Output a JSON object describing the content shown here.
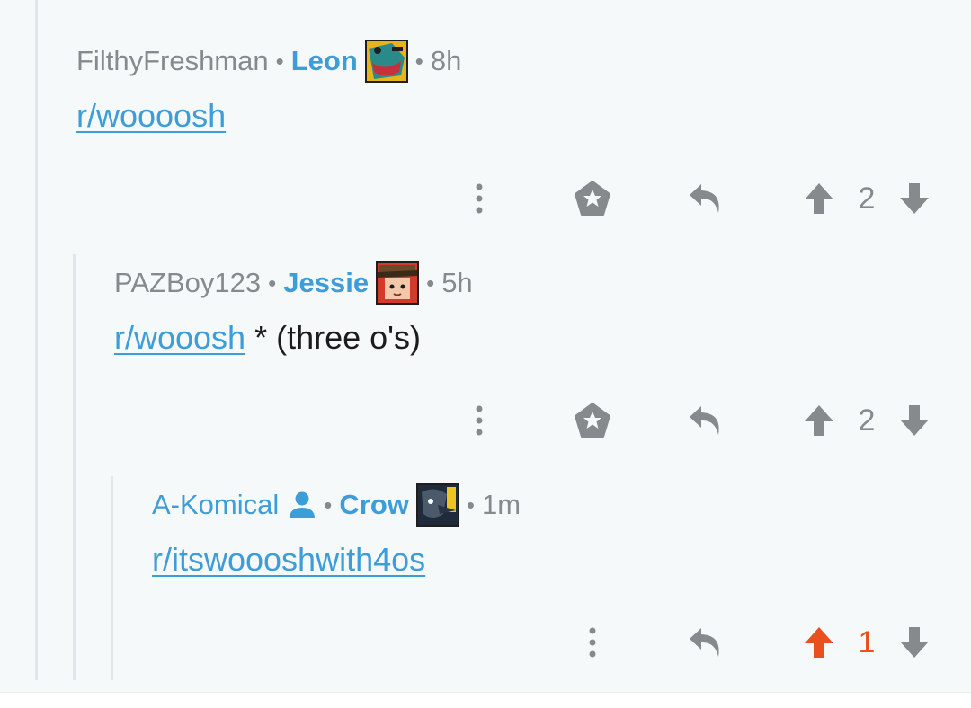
{
  "comments": [
    {
      "author": "FilthyFreshman",
      "flair": "Leon",
      "time": "8h",
      "link": "r/woooosh",
      "text_after": "",
      "score": "2",
      "upvoted": false
    },
    {
      "author": "PAZBoy123",
      "flair": "Jessie",
      "time": "5h",
      "link": "r/wooosh",
      "text_after": " * (three o's)",
      "score": "2",
      "upvoted": false
    },
    {
      "author": "A-Komical",
      "flair": "Crow",
      "time": "1m",
      "link": "r/itswoooshwith4os",
      "text_after": "",
      "score": "1",
      "upvoted": true
    }
  ],
  "separator": "•",
  "colors": {
    "link": "#3d9dd8",
    "muted": "#878a8c",
    "upvote": "#e8501e"
  },
  "icons": [
    "more-icon",
    "award-icon",
    "reply-icon",
    "upvote-icon",
    "downvote-icon",
    "user-icon"
  ]
}
